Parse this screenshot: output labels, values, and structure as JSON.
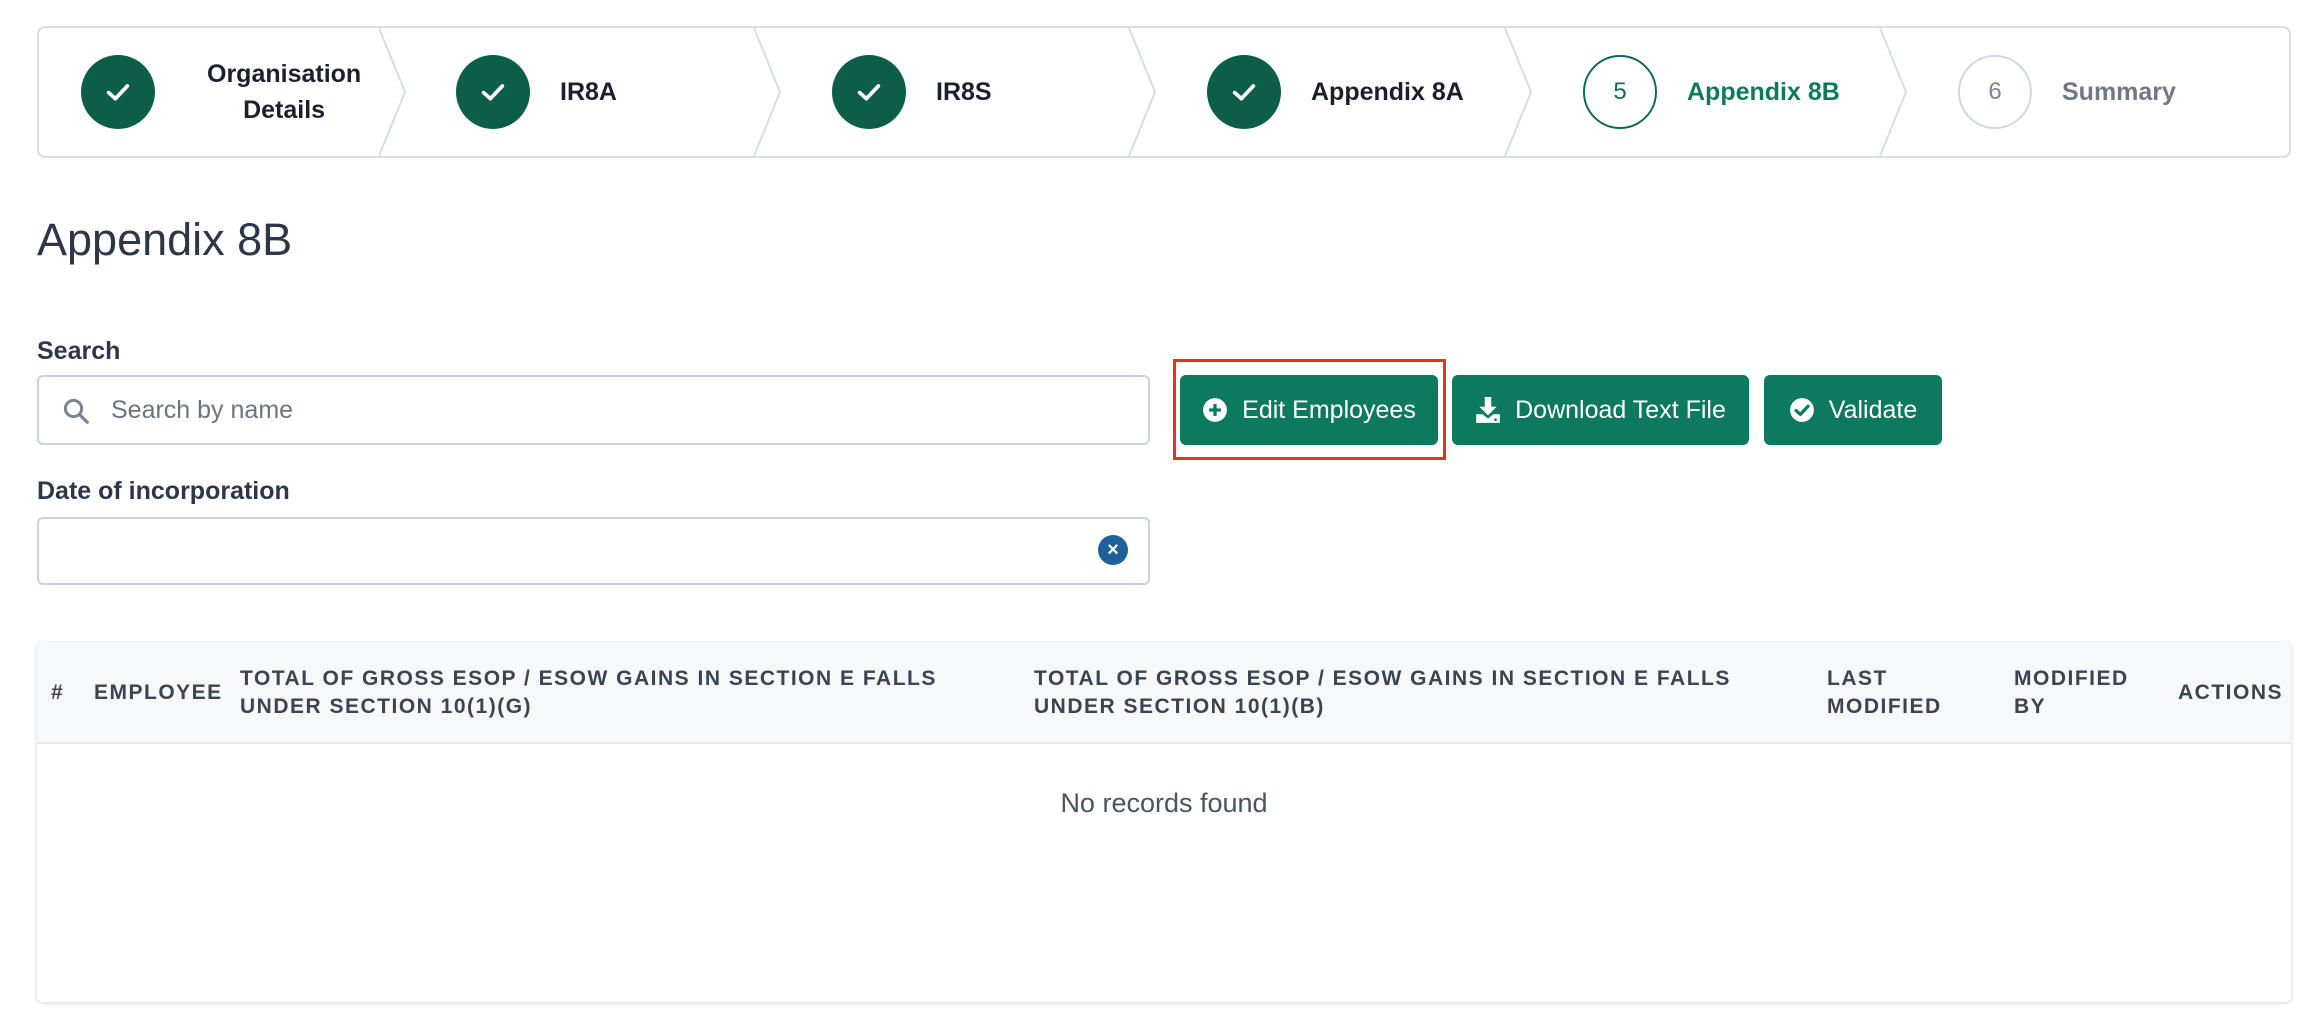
{
  "stepper": {
    "steps": [
      {
        "label_line1": "Organisation",
        "label_line2": "Details",
        "state": "done"
      },
      {
        "label": "IR8A",
        "state": "done"
      },
      {
        "label": "IR8S",
        "state": "done"
      },
      {
        "label": "Appendix 8A",
        "state": "done"
      },
      {
        "number": "5",
        "label": "Appendix 8B",
        "state": "active"
      },
      {
        "number": "6",
        "label": "Summary",
        "state": "pending"
      }
    ]
  },
  "page": {
    "title": "Appendix 8B"
  },
  "search": {
    "label": "Search",
    "placeholder": "Search by name",
    "value": ""
  },
  "date_of_incorporation": {
    "label": "Date of incorporation",
    "value": ""
  },
  "actions": {
    "edit_employees": "Edit Employees",
    "download_text_file": "Download Text File",
    "validate": "Validate"
  },
  "table": {
    "columns": [
      "#",
      "EMPLOYEE",
      "TOTAL OF GROSS ESOP / ESOW GAINS IN SECTION E FALLS UNDER SECTION 10(1)(G)",
      "TOTAL OF GROSS ESOP / ESOW GAINS IN SECTION E FALLS UNDER SECTION 10(1)(B)",
      "LAST MODIFIED",
      "MODIFIED BY",
      "ACTIONS"
    ],
    "rows": [],
    "empty_message": "No records found"
  },
  "colors": {
    "primary": "#0d7a5f",
    "step_done": "#0d5e48",
    "highlight": "#e0361c",
    "clear_icon": "#1f5f9a"
  }
}
